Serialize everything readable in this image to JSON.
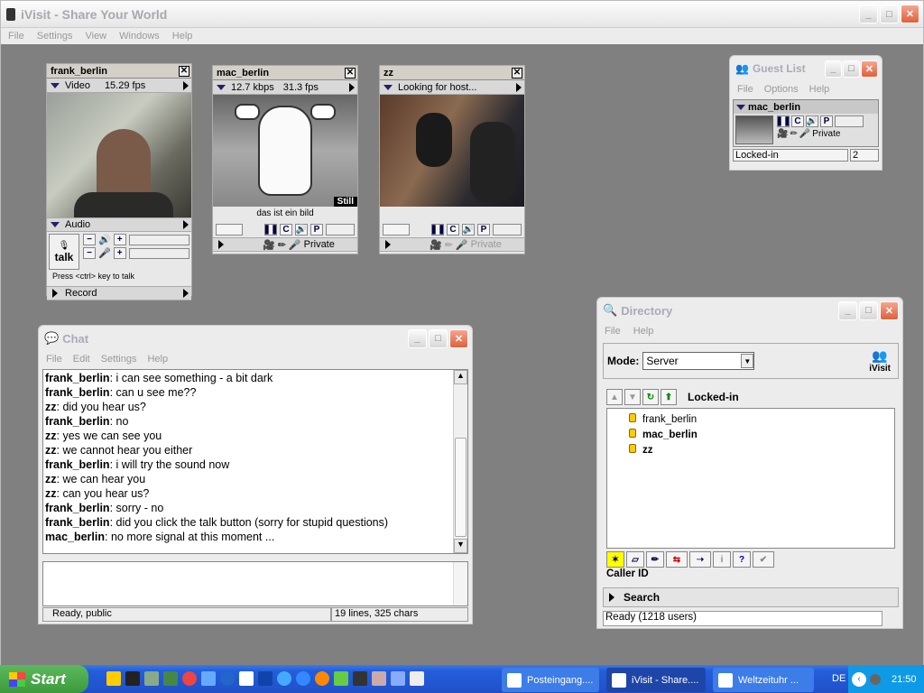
{
  "main": {
    "title": "iVisit - Share Your World",
    "menu": [
      "File",
      "Settings",
      "View",
      "Windows",
      "Help"
    ]
  },
  "video_windows": [
    {
      "name": "frank_berlin",
      "status": "Video",
      "fps": "15.29  fps"
    },
    {
      "name": "mac_berlin",
      "kbps": "12.7 kbps",
      "fps": "31.3 fps",
      "caption": "das ist ein bild",
      "still_label": "Still",
      "private_label": "Private"
    },
    {
      "name": "zz",
      "status": "Looking for host...",
      "private_label": "Private"
    }
  ],
  "audio": {
    "label": "Audio",
    "talk": "talk",
    "hint": "Press <ctrl> key to talk",
    "record": "Record"
  },
  "guest_list": {
    "title": "Guest List",
    "menu": [
      "File",
      "Options",
      "Help"
    ],
    "guest": "mac_berlin",
    "private_label": "Private",
    "status": "Locked-in",
    "count": "2"
  },
  "chat": {
    "title": "Chat",
    "menu": [
      "File",
      "Edit",
      "Settings",
      "Help"
    ],
    "lines": [
      {
        "user": "frank_berlin",
        "text": ": i can see something - a bit dark"
      },
      {
        "user": "frank_berlin",
        "text": ": can u see me??"
      },
      {
        "user": "zz",
        "text": ":  did you hear us?"
      },
      {
        "user": "frank_berlin",
        "text": ": no"
      },
      {
        "user": "zz",
        "text": ": yes we can see you"
      },
      {
        "user": "zz",
        "text": ": we cannot hear you either"
      },
      {
        "user": "frank_berlin",
        "text": ": i will try the sound now"
      },
      {
        "user": "zz",
        "text": ": we can hear you"
      },
      {
        "user": "zz",
        "text": ": can you hear us?"
      },
      {
        "user": "frank_berlin",
        "text": ": sorry - no"
      },
      {
        "user": "frank_berlin",
        "text": ": did you click the talk button (sorry for stupid questions)"
      },
      {
        "user": "mac_berlin",
        "text": ": no more signal at this moment ..."
      }
    ],
    "status_left": "Ready, public",
    "status_right": "19 lines, 325 chars"
  },
  "directory": {
    "title": "Directory",
    "menu": [
      "File",
      "Help"
    ],
    "mode_label": "Mode:",
    "mode_value": "Server",
    "logo_text": "iVisit",
    "section": "Locked-in",
    "users": [
      {
        "name": "frank_berlin",
        "bold": false
      },
      {
        "name": "mac_berlin",
        "bold": true
      },
      {
        "name": "zz",
        "bold": true
      }
    ],
    "caller_id": "Caller ID",
    "search": "Search",
    "status": "Ready  (1218 users)"
  },
  "taskbar": {
    "start": "Start",
    "tasks": [
      "Posteingang....",
      "iVisit - Share....",
      "Weltzeituhr ..."
    ],
    "lang": "DE",
    "time": "21:50"
  },
  "colors": {
    "desktop": "#808080",
    "taskbar": "#245edb",
    "start": "#3c9a3c"
  }
}
